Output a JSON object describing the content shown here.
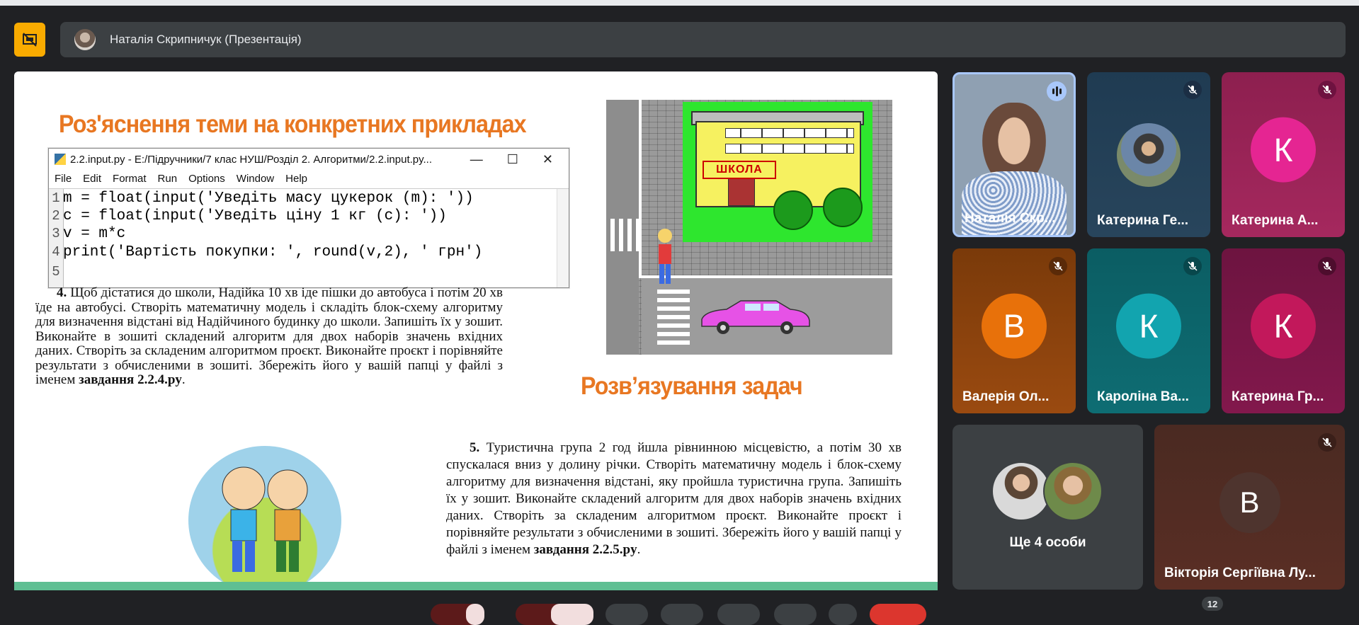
{
  "header": {
    "presenter_name": "Наталія Скрипничук (Презентація)"
  },
  "slide": {
    "title_1": "Роз'яснення теми на конкретних прикладах",
    "title_2": "Розв’язування задач",
    "idle": {
      "window_title": "2.2.input.py - E:/Підручники/7 клас НУШ/Розділ 2. Алгоритми/2.2.input.py...",
      "menu": [
        "File",
        "Edit",
        "Format",
        "Run",
        "Options",
        "Window",
        "Help"
      ],
      "code_lines": [
        {
          "n": "1",
          "text": "m = float(input('Уведіть масу цукерок (m): '))"
        },
        {
          "n": "2",
          "text": "c = float(input('Уведіть ціну 1 кг (c): '))"
        },
        {
          "n": "3",
          "text": "v = m*c"
        },
        {
          "n": "4",
          "text": "print('Вартість покупки: ', round(v,2), ' грн')"
        },
        {
          "n": "5",
          "text": ""
        }
      ]
    },
    "school_sign": "ШКОЛА",
    "task4": {
      "number": "4.",
      "text": "Щоб дістатися до школи, Надійка 10 хв іде пішки до автобуса і потім 20 хв їде на автобусі. Створіть математичну модель і складіть блок-схему алгоритму для визначення відстані від Надійчиного будинку до школи. Запишіть їх у зошит. Виконайте в зошиті складений алгоритм для двох наборів значень вхідних даних. Створіть за складеним алгоритмом проєкт. Виконайте проєкт і порівняйте результати з обчисленими в зошиті. Збережіть його у вашій папці у файлі з іменем",
      "file": "завдання 2.2.4.py",
      "end": "."
    },
    "task5": {
      "number": "5.",
      "text": "Туристична група 2 год йшла рівнинною місцевістю, а потім 30 хв спускалася вниз у долину річки. Створіть математичну модель і блок-схему алгоритму для визначення відстані, яку пройшла туристична група. Запишіть їх у зошит. Виконайте складений алгоритм для двох наборів значень вхідних даних. Створіть за складеним алгоритмом проєкт. Виконайте проєкт і порівняйте результати з обчисленими в зошиті. Збережіть його у вашій папці у файлі з іменем",
      "file": "завдання 2.2.5.py",
      "end": "."
    }
  },
  "participants": [
    {
      "name": "Наталія Скр...",
      "state": "speaking"
    },
    {
      "name": "Катерина Ге...",
      "state": "muted"
    },
    {
      "name": "Катерина А...",
      "initial": "К",
      "color": "#e52592",
      "state": "muted"
    },
    {
      "name": "Валерія Ол...",
      "initial": "В",
      "color": "#e8710a",
      "state": "muted"
    },
    {
      "name": "Кароліна Ва...",
      "initial": "К",
      "color": "#12a4af",
      "state": "muted"
    },
    {
      "name": "Катерина Гр...",
      "initial": "К",
      "color": "#c2185b",
      "state": "muted"
    },
    {
      "more_label": "Ще 4 особи"
    },
    {
      "name": "Вікторія Сергіївна Лу...",
      "initial": "В",
      "color": "#4e342e",
      "state": "muted"
    }
  ],
  "controls": {
    "participants_count": "12"
  },
  "colors": {
    "accent_present": "#f9ab00",
    "slide_title": "#e87722"
  }
}
